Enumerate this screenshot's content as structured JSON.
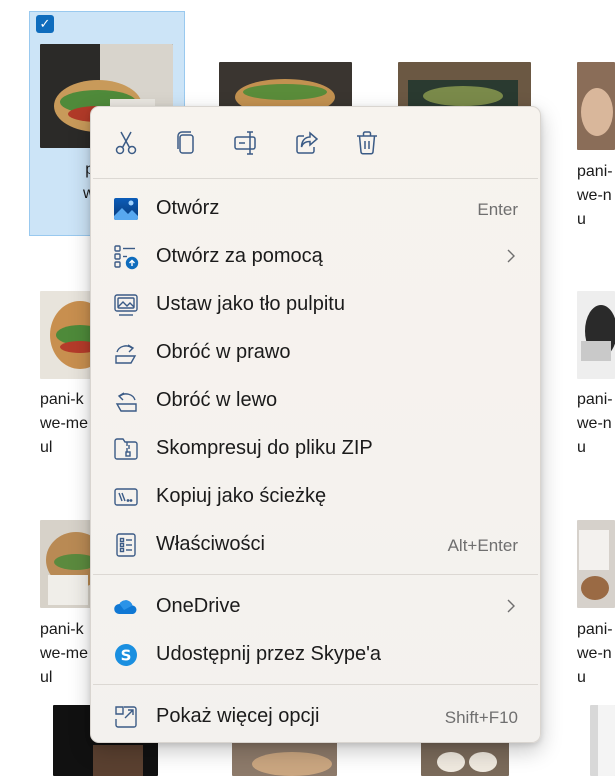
{
  "files": [
    {
      "name_line1": "pani-k",
      "name_line2": "we-me",
      "name_line3": "ul",
      "selected": true
    },
    {
      "name_line1": "pani-",
      "name_line2": "we-n",
      "name_line3": "u"
    },
    {
      "name_line1": "pani-k",
      "name_line2": "we-me",
      "name_line3": "ul"
    },
    {
      "name_line1": "pani-",
      "name_line2": "we-n",
      "name_line3": "u"
    },
    {
      "name_line1": "pani-k",
      "name_line2": "we-me",
      "name_line3": "ul"
    },
    {
      "name_line1": "pani-",
      "name_line2": "we-n",
      "name_line3": "u"
    }
  ],
  "toolbar": {
    "cut": "cut-icon",
    "copy": "copy-icon",
    "rename": "rename-icon",
    "share": "share-icon",
    "delete": "delete-icon"
  },
  "menu": {
    "open": {
      "label": "Otwórz",
      "shortcut": "Enter"
    },
    "open_with": {
      "label": "Otwórz za pomocą"
    },
    "set_wallpaper": {
      "label": "Ustaw jako tło pulpitu"
    },
    "rotate_right": {
      "label": "Obróć w prawo"
    },
    "rotate_left": {
      "label": "Obróć w lewo"
    },
    "compress_zip": {
      "label": "Skompresuj do pliku ZIP"
    },
    "copy_path": {
      "label": "Kopiuj jako ścieżkę"
    },
    "properties": {
      "label": "Właściwości",
      "shortcut": "Alt+Enter"
    },
    "onedrive": {
      "label": "OneDrive"
    },
    "skype": {
      "label": "Udostępnij przez Skype'a"
    },
    "more_options": {
      "label": "Pokaż więcej opcji",
      "shortcut": "Shift+F10"
    }
  },
  "colors": {
    "accent": "#0f6cbd",
    "selection": "#cce4f7",
    "icon": "#3b5b86"
  }
}
